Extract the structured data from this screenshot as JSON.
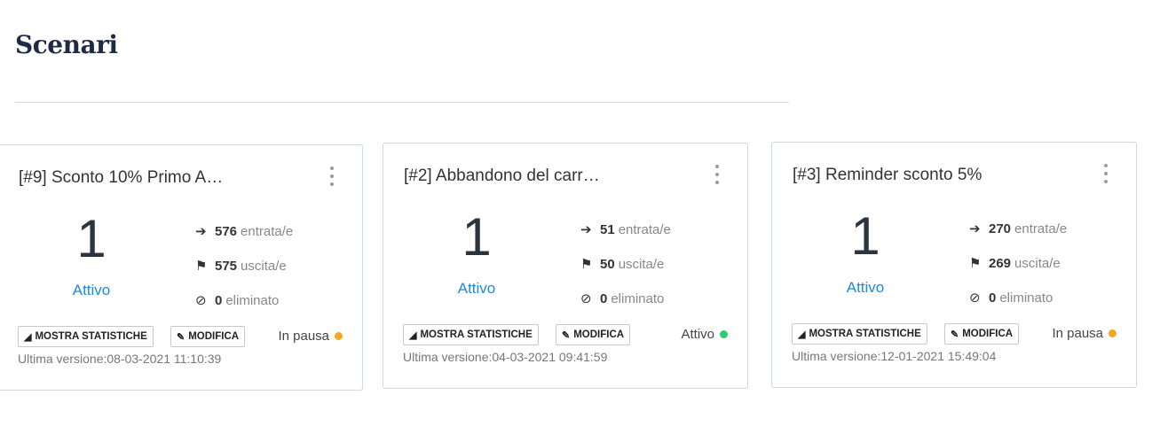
{
  "page": {
    "title": "Scenari"
  },
  "cards": [
    {
      "title": "[#9] Sconto 10% Primo A…",
      "active_count": "1",
      "active_label": "Attivo",
      "entered": "576",
      "entered_label": "entrata/e",
      "exited": "575",
      "exited_label": "uscita/e",
      "deleted": "0",
      "deleted_label": "eliminato",
      "stats_button": "MOSTRA STATISTICHE",
      "edit_button": "MODIFICA",
      "status": "In pausa",
      "status_color": "#f5a623",
      "version": "Ultima versione:08-03-2021 11:10:39"
    },
    {
      "title": "[#2] Abbandono del carr…",
      "active_count": "1",
      "active_label": "Attivo",
      "entered": "51",
      "entered_label": "entrata/e",
      "exited": "50",
      "exited_label": "uscita/e",
      "deleted": "0",
      "deleted_label": "eliminato",
      "stats_button": "MOSTRA STATISTICHE",
      "edit_button": "MODIFICA",
      "status": "Attivo",
      "status_color": "#2ecc71",
      "version": "Ultima versione:04-03-2021 09:41:59"
    },
    {
      "title": "[#3] Reminder sconto 5%",
      "active_count": "1",
      "active_label": "Attivo",
      "entered": "270",
      "entered_label": "entrata/e",
      "exited": "269",
      "exited_label": "uscita/e",
      "deleted": "0",
      "deleted_label": "eliminato",
      "stats_button": "MOSTRA STATISTICHE",
      "edit_button": "MODIFICA",
      "status": "In pausa",
      "status_color": "#f5a623",
      "version": "Ultima versione:12-01-2021 15:49:04"
    }
  ],
  "icons": {
    "entered": "sign-in-icon",
    "exited": "flag-checkered-icon",
    "deleted": "ban-icon",
    "stats": "area-chart-icon",
    "edit": "pencil-icon",
    "menu": "kebab-menu-icon"
  }
}
